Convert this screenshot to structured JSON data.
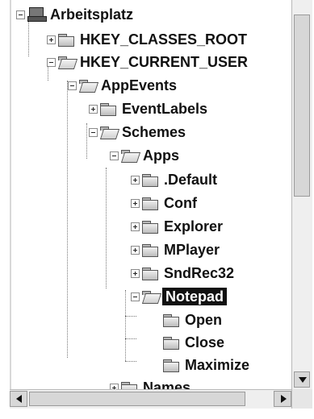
{
  "tree": {
    "root_label": "Arbeitsplatz",
    "items": [
      {
        "label": "HKEY_CLASSES_ROOT"
      },
      {
        "label": "HKEY_CURRENT_USER"
      },
      {
        "label": "AppEvents"
      },
      {
        "label": "EventLabels"
      },
      {
        "label": "Schemes"
      },
      {
        "label": "Apps"
      },
      {
        "label": ".Default"
      },
      {
        "label": "Conf"
      },
      {
        "label": "Explorer"
      },
      {
        "label": "MPlayer"
      },
      {
        "label": "SndRec32"
      },
      {
        "label": "Notepad"
      },
      {
        "label": "Open"
      },
      {
        "label": "Close"
      },
      {
        "label": "Maximize"
      },
      {
        "label": "Names"
      }
    ]
  },
  "icons": {
    "computer": "computer-icon",
    "folder": "folder-icon",
    "open_folder": "folder-open-icon"
  },
  "colors": {
    "selected_background": "#111111",
    "selected_text": "#ffffff",
    "text": "#111111"
  }
}
